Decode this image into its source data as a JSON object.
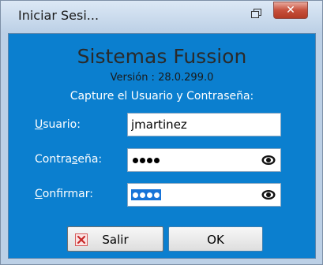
{
  "window": {
    "title": "Iniciar Sesi...",
    "restore_icon": "restore-icon",
    "close_icon": "close-icon",
    "close_glyph": "✕"
  },
  "header": {
    "app_title": "Sistemas Fussion",
    "version": "Versión : 28.0.299.0",
    "instruction": "Capture el Usuario y Contraseña:"
  },
  "form": {
    "usuario": {
      "label_u": "U",
      "label_rest": "suario:",
      "value": "jmartinez"
    },
    "contrasena": {
      "label_pre": "Contra",
      "label_u": "s",
      "label_rest": "eña:",
      "masked_length": 4
    },
    "confirmar": {
      "label_u": "C",
      "label_rest": "onfirmar:",
      "masked_length": 4,
      "selected": true
    }
  },
  "buttons": {
    "salir": "Salir",
    "salir_icon": "cancel-x-icon",
    "ok": "OK"
  },
  "colors": {
    "panel": "#0b7fcf",
    "close_button": "#c7503c",
    "selection": "#1874d8"
  }
}
